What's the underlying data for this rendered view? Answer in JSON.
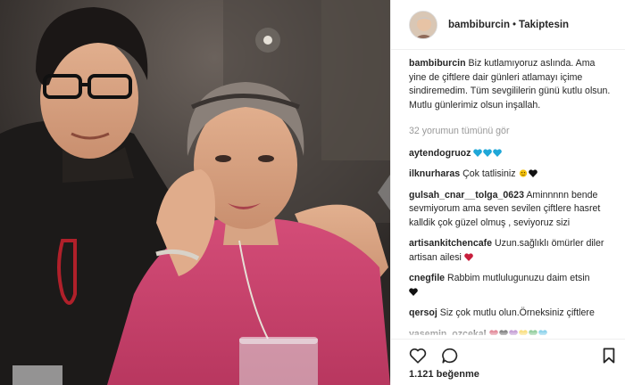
{
  "header": {
    "username": "bambiburcin",
    "separator": "•",
    "follow_label": "Takiptesin"
  },
  "caption": {
    "user": "bambiburcin",
    "text": "Biz kutlamıyoruz aslında. Ama yine de çiftlere dair günleri atlamayı içime sindiremedim. Tüm sevgililerin günü kutlu olsun. Mutlu günlerimiz olsun inşallah."
  },
  "view_all_comments": "32 yorumun tümünü gör",
  "comments": [
    {
      "user": "aytendogruoz",
      "text": "",
      "emoji_names": [
        "blue-heart",
        "blue-heart",
        "blue-heart"
      ]
    },
    {
      "user": "ilknurharas",
      "text": "Çok tatlisiniz",
      "emoji_names": [
        "face-emoji",
        "black-heart"
      ]
    },
    {
      "user": "gulsah_cnar__tolga_0623",
      "text": "Aminnnnn bende sevmiyorum ama seven sevilen çiftlere hasret kalldik çok güzel olmuş , seviyoruz sizi",
      "emoji_names": []
    },
    {
      "user": "artisankitchencafe",
      "text": "Uzun.sağlıklı ömürler diler artisan ailesi",
      "emoji_names": [
        "red-heart"
      ]
    },
    {
      "user": "cnegfile",
      "text": "Rabbim mutlulugunuzu daim etsin",
      "emoji_names": [
        "black-heart"
      ]
    },
    {
      "user": "qersoj",
      "text": "Siz çok mutlu olun.Örneksiniz çiftlere",
      "emoji_names": []
    },
    {
      "user": "yasemin_ozcekal",
      "text": "",
      "emoji_names": [
        "red-heart",
        "black-heart",
        "purple-heart",
        "yellow-heart",
        "green-heart",
        "blue-heart"
      ]
    }
  ],
  "likes": {
    "count": "1.121",
    "label": "beğenme"
  },
  "colors": {
    "blue_heart": "#1fa7d8",
    "red_heart": "#c81e3c",
    "purple_heart": "#8e44ad",
    "yellow_heart": "#f4c20d",
    "green_heart": "#2ea043",
    "muted_text": "#999999"
  },
  "icons": [
    "heart-outline-icon",
    "comment-bubble-icon",
    "bookmark-icon",
    "photo-next-arrow-icon"
  ]
}
